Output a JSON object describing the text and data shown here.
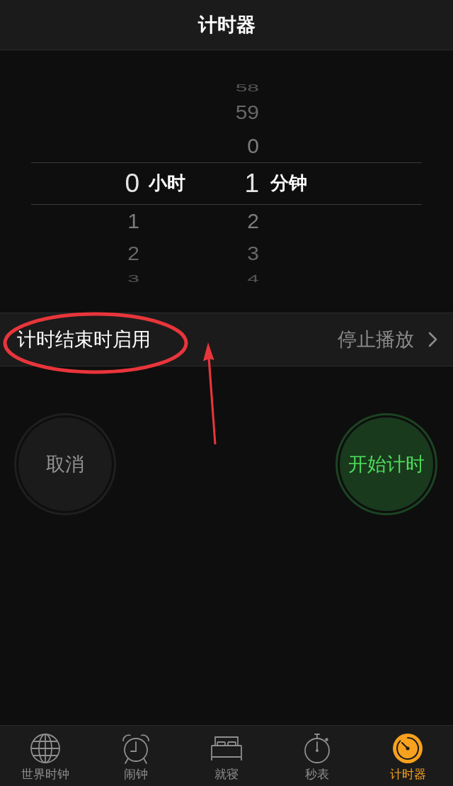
{
  "nav_bar": {
    "title": "计时器"
  },
  "picker": {
    "columns": [
      {
        "unit": "小时",
        "selected": "0",
        "below": [
          "1",
          "2",
          "3"
        ]
      },
      {
        "unit": "分钟",
        "above": [
          "58",
          "59",
          "0"
        ],
        "selected": "1",
        "below": [
          "2",
          "3",
          "4"
        ]
      }
    ]
  },
  "settings_row": {
    "label": "计时结束时启用",
    "value": "停止播放"
  },
  "buttons": [
    {
      "kind": "cancel",
      "label": "取消"
    },
    {
      "kind": "start",
      "label": "开始计时"
    }
  ],
  "annotations": {
    "highlight_ellipse": true,
    "pointer_arrow": true
  },
  "tab_bar": [
    {
      "label": "世界时钟",
      "selected": false
    },
    {
      "label": "闹钟",
      "selected": false
    },
    {
      "label": "就寝",
      "selected": false
    },
    {
      "label": "秒表",
      "selected": false
    },
    {
      "label": "计时器",
      "selected": true
    }
  ]
}
